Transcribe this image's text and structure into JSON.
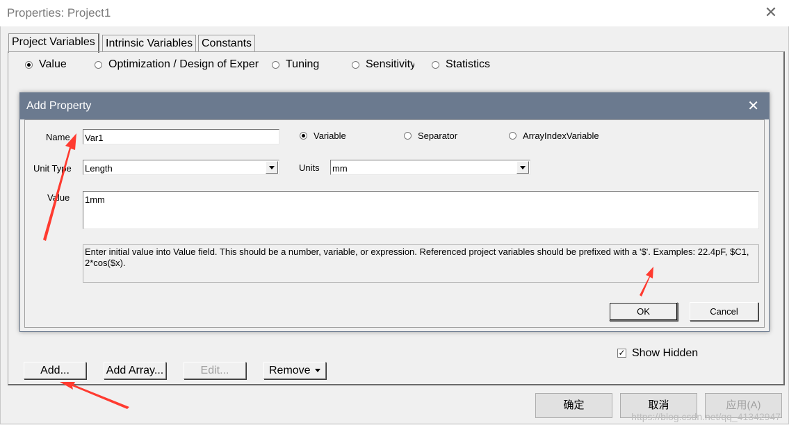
{
  "window": {
    "title": "Properties: Project1"
  },
  "tabs": [
    "Project Variables",
    "Intrinsic Variables",
    "Constants"
  ],
  "mode_options": [
    {
      "label": "Value",
      "selected": true
    },
    {
      "label": "Optimization / Design of Exper",
      "selected": false
    },
    {
      "label": "Tuning",
      "selected": false
    },
    {
      "label": "Sensitivity",
      "selected": false
    },
    {
      "label": "Statistics",
      "selected": false
    }
  ],
  "dialog": {
    "title": "Add Property",
    "name_label": "Name",
    "name_value": "Var1",
    "kind_options": [
      {
        "label": "Variable",
        "selected": true
      },
      {
        "label": "Separator",
        "selected": false
      },
      {
        "label": "ArrayIndexVariable",
        "selected": false
      }
    ],
    "unit_type_label": "Unit Type",
    "unit_type_value": "Length",
    "units_label": "Units",
    "units_value": "mm",
    "value_label": "Value",
    "value_value": "1mm",
    "hint": "Enter initial value into Value field. This should be a number, variable, or expression. Referenced project variables should be prefixed with a '$'. Examples: 22.4pF, $C1, 2*cos($x).",
    "ok_label": "OK",
    "cancel_label": "Cancel"
  },
  "show_hidden": {
    "label": "Show Hidden",
    "checked": true
  },
  "actions": {
    "add": "Add...",
    "add_array": "Add Array...",
    "edit": "Edit...",
    "remove": "Remove"
  },
  "footer": {
    "ok": "确定",
    "cancel": "取消",
    "apply": "应用(A)"
  },
  "watermark": "https://blog.csdn.net/qq_41342947",
  "colors": {
    "dialog_title_bg": "#6b7a8f",
    "annotation_arrow": "#ff3b30"
  }
}
